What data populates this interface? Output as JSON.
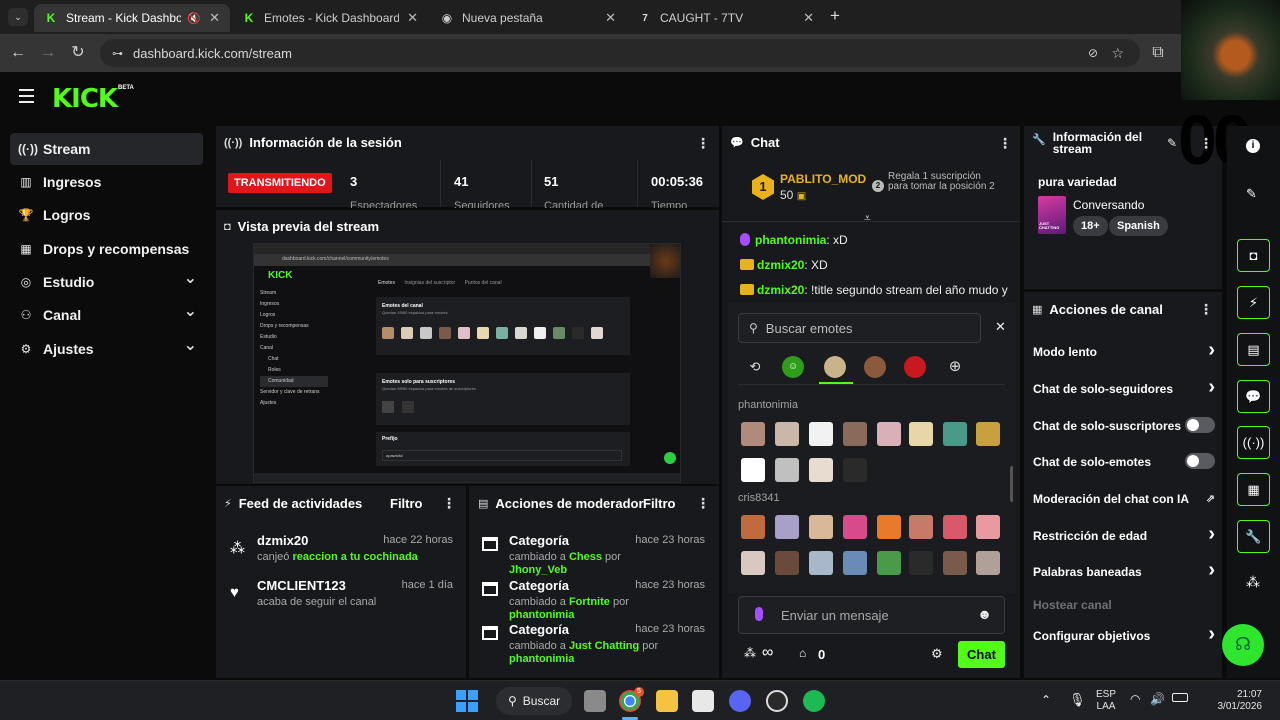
{
  "browser": {
    "tabs": [
      {
        "label": "Stream - Kick Dashboard",
        "active": true
      },
      {
        "label": "Emotes - Kick Dashboard",
        "active": false
      },
      {
        "label": "Nueva pestaña",
        "active": false
      },
      {
        "label": "CAUGHT - 7TV",
        "active": false
      }
    ],
    "new_tab": "+",
    "url": "dashboard.kick.com/stream"
  },
  "app": {
    "logo": "KICK",
    "beta": "BETA",
    "brand_color": "#53fc18"
  },
  "sidebar": {
    "items": [
      {
        "label": "Stream",
        "icon": "broadcast-icon",
        "glyph": "((·))",
        "active": true,
        "chevron": false
      },
      {
        "label": "Ingresos",
        "icon": "chart-icon",
        "glyph": "▥",
        "active": false,
        "chevron": false
      },
      {
        "label": "Logros",
        "icon": "trophy-icon",
        "glyph": "🏆",
        "active": false,
        "chevron": false
      },
      {
        "label": "Drops y recompensas",
        "icon": "gift-icon",
        "glyph": "▦",
        "active": false,
        "chevron": false
      },
      {
        "label": "Estudio",
        "icon": "studio-icon",
        "glyph": "◎",
        "active": false,
        "chevron": true
      },
      {
        "label": "Canal",
        "icon": "users-icon",
        "glyph": "⚇",
        "active": false,
        "chevron": true
      },
      {
        "label": "Ajustes",
        "icon": "gear-icon",
        "glyph": "⚙",
        "active": false,
        "chevron": true
      }
    ]
  },
  "session": {
    "title": "Información de la sesión",
    "status": "TRANSMITIENDO",
    "stats": [
      {
        "value": "3",
        "label": "Espectadores"
      },
      {
        "value": "41",
        "label": "Seguidores"
      },
      {
        "value": "51",
        "label": "Cantidad de"
      },
      {
        "value": "00:05:36",
        "label": "Tiempo"
      }
    ]
  },
  "preview": {
    "title": "Vista previa del stream",
    "overlay_text": "00",
    "inner_url": "dashboard.kick.com/channel/community/emotes",
    "inner_sidebar": [
      "Stream",
      "Ingresos",
      "Logros",
      "Drops y recompensas",
      "Estudio",
      "Canal",
      "Chat",
      "Roles",
      "Comunidad",
      "Servidor y clave de retrans",
      "Ajustes"
    ],
    "inner_tabs": [
      "Emotes",
      "Insignias del suscriptor",
      "Puntos del canal"
    ],
    "inner_sections": [
      {
        "title": "Emotes del canal",
        "sub": "Quedan 49/60 espacios para emotes"
      },
      {
        "title": "Emotes solo para suscriptores",
        "sub": "Quedan 59/60 espacios para emotes de suscriptores"
      },
      {
        "title": "Prefijo",
        "sub": "apawtoful"
      }
    ]
  },
  "feed": {
    "title": "Feed de actividades",
    "filter": "Filtro",
    "items": [
      {
        "name": "dzmix20",
        "time": "hace 22 horas",
        "verb": "canjeó",
        "highlight": "reaccion a tu cochinada",
        "icon": "points-icon"
      },
      {
        "name": "CMCLIENT123",
        "time": "hace 1 día",
        "verb": "acaba de seguir el canal",
        "highlight": "",
        "icon": "heart-icon"
      }
    ]
  },
  "modactions": {
    "title": "Acciones de moderador",
    "filter": "Filtro",
    "items": [
      {
        "title": "Categoría",
        "time": "hace 23 horas",
        "prefix": "cambiado a",
        "category": "Chess",
        "by": "por",
        "user": "Jhony_Veb"
      },
      {
        "title": "Categoría",
        "time": "hace 23 horas",
        "prefix": "cambiado a",
        "category": "Fortnite",
        "by": "por",
        "user": "phantonimia"
      },
      {
        "title": "Categoría",
        "time": "hace 23 horas",
        "prefix": "cambiado a",
        "category": "Just Chatting",
        "by": "por",
        "user": "phantonimia"
      }
    ]
  },
  "chat": {
    "title": "Chat",
    "pinned": {
      "rank": "1",
      "user": "PABLITO_MOD",
      "count": "50",
      "gift_rank": "2",
      "gift_text": "Regala 1 suscripción para tomar la posición 2"
    },
    "messages": [
      {
        "user": "phantonimia",
        "text": ": xD",
        "badge": "mic"
      },
      {
        "user": "dzmix20",
        "text": ": XD",
        "badge": "crown"
      },
      {
        "user": "dzmix20",
        "text": ": !title segundo stream del año mudo y",
        "badge": "crown"
      }
    ],
    "emote_search_placeholder": "Buscar emotes",
    "emote_sections": [
      "phantonimia",
      "cris8341"
    ],
    "input_placeholder": "Enviar un mensaje",
    "points": "∞",
    "gifts": "0",
    "send_label": "Chat"
  },
  "streaminfo": {
    "title": "Información del stream",
    "stream_title": "pura variedad",
    "category": "Conversando",
    "category_thumb": "JUST CHATTING",
    "tags": [
      "18+",
      "Spanish"
    ],
    "overlay": "00"
  },
  "channel_actions": {
    "title": "Acciones de canal",
    "rows": [
      {
        "label": "Modo lento",
        "control": "chevron"
      },
      {
        "label": "Chat de solo-seguidores",
        "control": "chevron"
      },
      {
        "label": "Chat de solo-suscriptores",
        "control": "toggle"
      },
      {
        "label": "Chat de solo-emotes",
        "control": "toggle"
      },
      {
        "label": "Moderación del chat con IA",
        "control": "external"
      },
      {
        "label": "Restricción de edad",
        "control": "chevron"
      },
      {
        "label": "Palabras baneadas",
        "control": "chevron"
      },
      {
        "label": "Hostear canal",
        "control": "none"
      },
      {
        "label": "Configurar objetivos",
        "control": "chevron"
      }
    ]
  },
  "taskbar": {
    "search": "Buscar",
    "lang": "ESP",
    "lang2": "LAA",
    "time": "21:07",
    "date": "3/01/2026",
    "chrome_badge": "5"
  }
}
